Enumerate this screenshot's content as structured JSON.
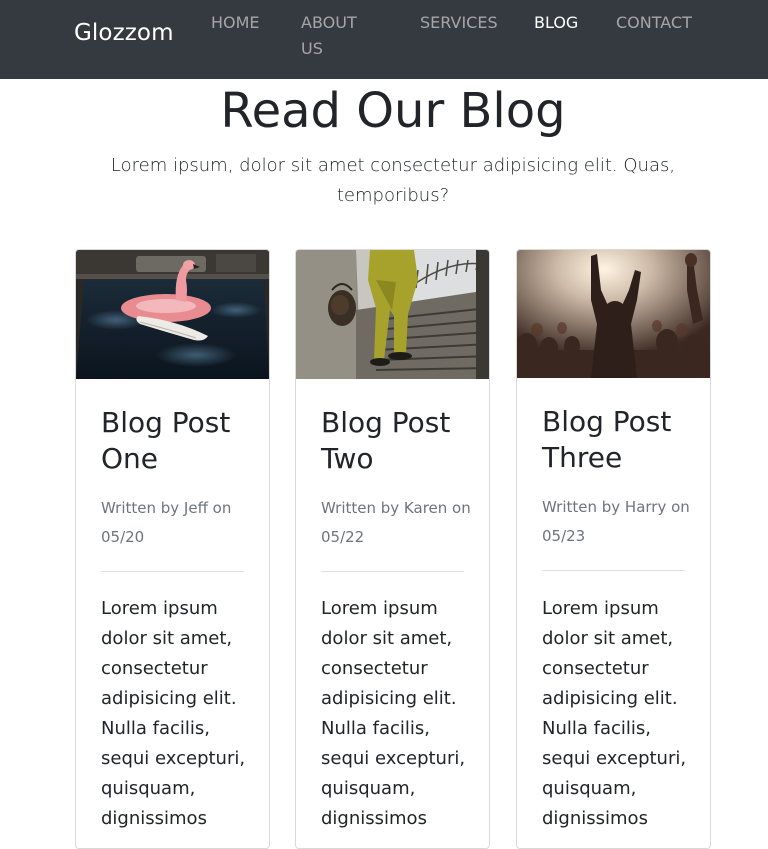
{
  "navbar": {
    "brand": "Glozzom",
    "links": [
      {
        "label": "HOME"
      },
      {
        "label": "ABOUT US"
      },
      {
        "label": "SERVICES"
      },
      {
        "label": "BLOG",
        "active": true
      },
      {
        "label": "CONTACT"
      }
    ]
  },
  "hero": {
    "title": "Read Our Blog",
    "lead": "Lorem ipsum, dolor sit amet consectetur adipisicing elit. Quas, temporibus?"
  },
  "posts": [
    {
      "title": "Blog Post One",
      "meta": "Written by Jeff on 05/20",
      "image": "pool-flamingo-float-photo",
      "excerpt": "Lorem ipsum dolor sit amet, consectetur adipisicing elit. Nulla facilis, sequi excepturi, quisquam, dignissimos"
    },
    {
      "title": "Blog Post Two",
      "meta": "Written by Karen on 05/22",
      "image": "fashion-stairs-photo",
      "excerpt": "Lorem ipsum dolor sit amet, consectetur adipisicing elit. Nulla facilis, sequi excepturi, quisquam, dignissimos"
    },
    {
      "title": "Blog Post Three",
      "meta": "Written by Harry on 05/23",
      "image": "concert-crowd-photo",
      "excerpt": "Lorem ipsum dolor sit amet, consectetur adipisicing elit. Nulla facilis, sequi excepturi, quisquam, dignissimos"
    }
  ],
  "colors": {
    "navbar_bg": "#343a40",
    "text": "#212529",
    "muted": "#6c757d"
  }
}
